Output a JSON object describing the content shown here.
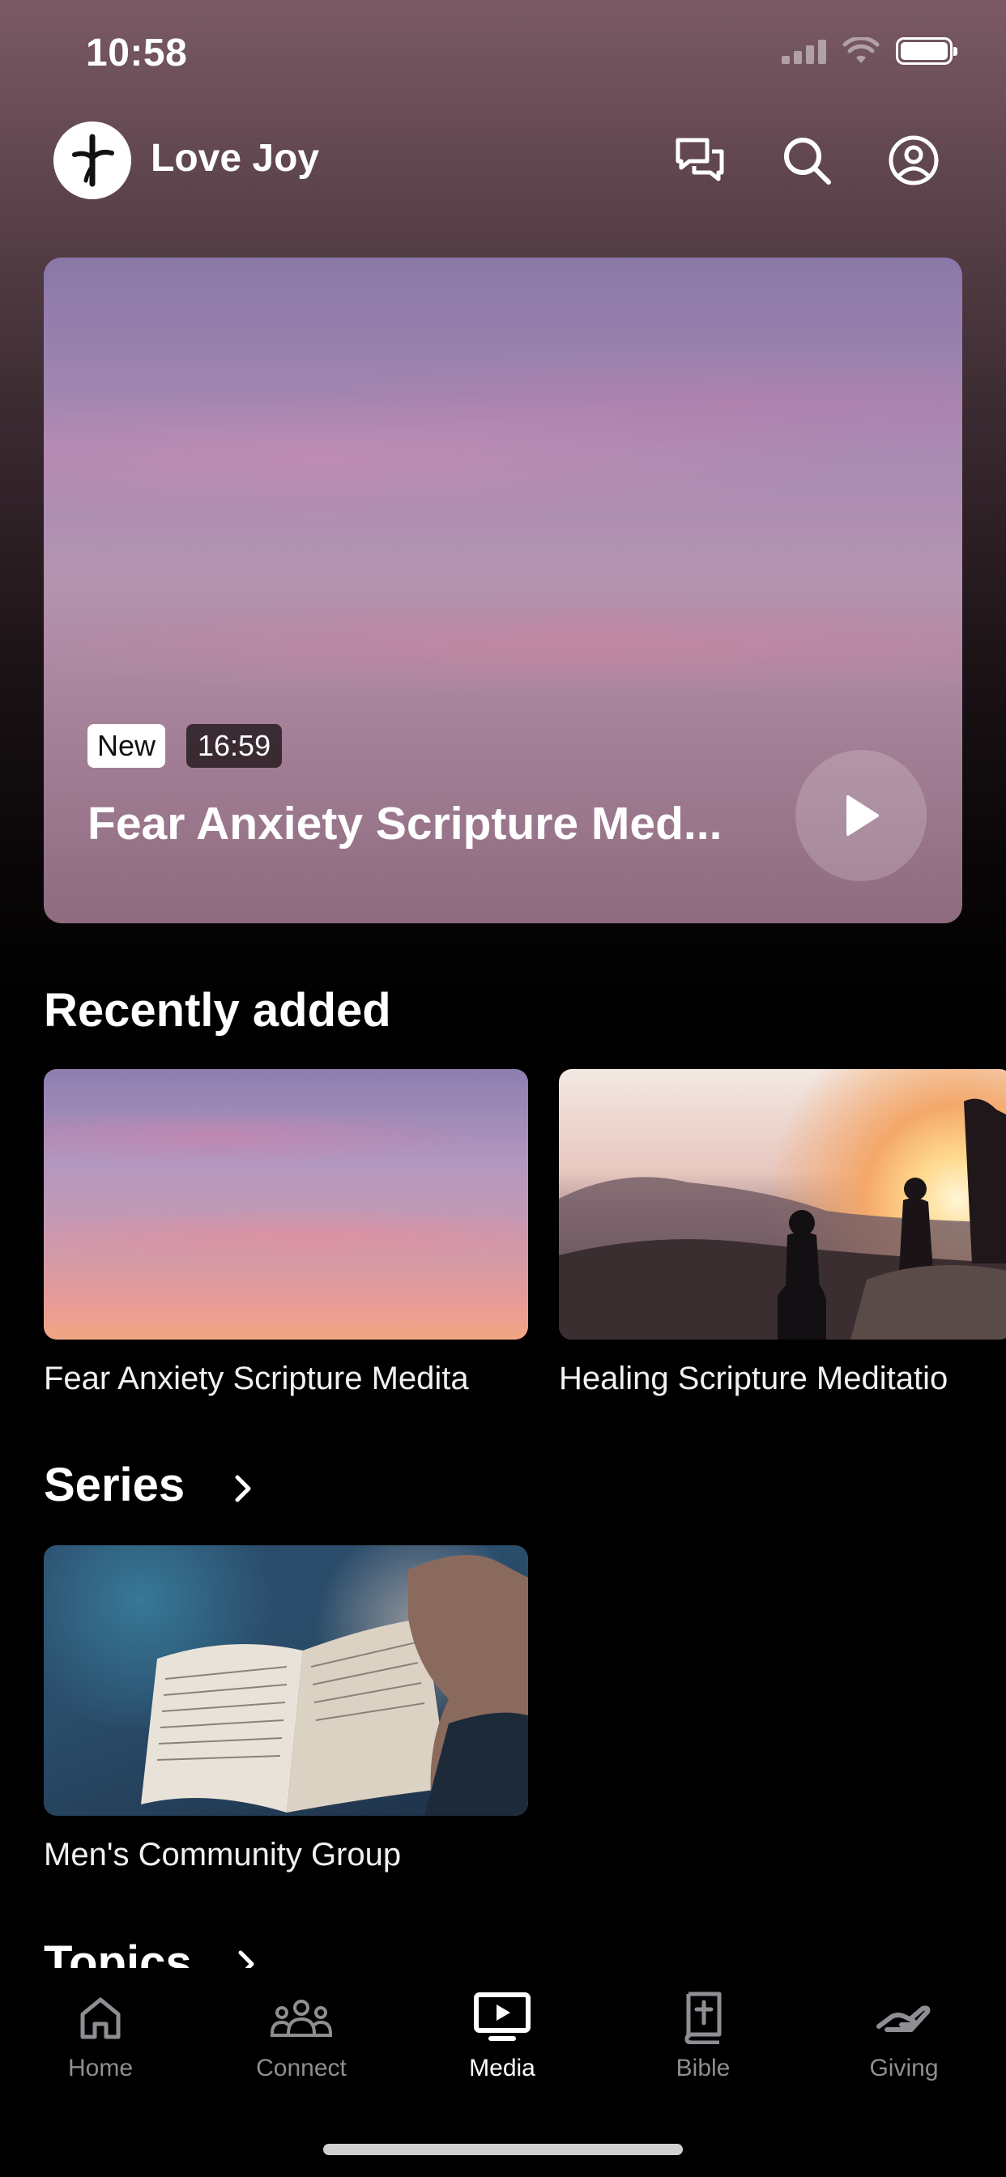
{
  "status_bar": {
    "time": "10:58"
  },
  "header": {
    "app_name": "Love Joy"
  },
  "hero": {
    "badge": "New",
    "duration": "16:59",
    "title": "Fear Anxiety Scripture Med..."
  },
  "recently_added": {
    "title": "Recently added",
    "items": [
      {
        "label": "Fear Anxiety Scripture Medita"
      },
      {
        "label": "Healing Scripture Meditatio"
      }
    ]
  },
  "series": {
    "title": "Series",
    "items": [
      {
        "label": "Men's Community Group"
      }
    ]
  },
  "topics": {
    "title": "Topics"
  },
  "tabs": [
    {
      "label": "Home",
      "icon": "home-icon"
    },
    {
      "label": "Connect",
      "icon": "people-icon"
    },
    {
      "label": "Media",
      "icon": "tv-play-icon",
      "active": true
    },
    {
      "label": "Bible",
      "icon": "bible-icon"
    },
    {
      "label": "Giving",
      "icon": "giving-icon"
    }
  ],
  "colors": {
    "background": "#000000",
    "tab_inactive": "#8e8e93",
    "tab_active": "#ffffff"
  }
}
